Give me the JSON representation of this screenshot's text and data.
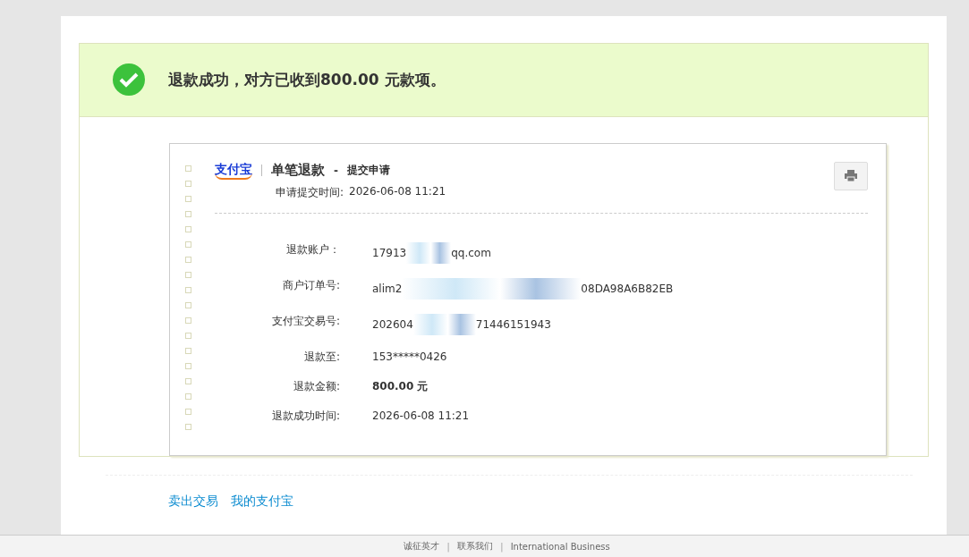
{
  "banner": {
    "message": "退款成功，对方已收到**800.00** 元款项。"
  },
  "receipt": {
    "brand": "支付宝",
    "title": "单笔退款",
    "separator": "-",
    "step": "提交申请",
    "submitted_label": "申请提交时间:",
    "submitted_time": "2026-06-08 11:21",
    "rows": [
      {
        "label": "退款账户：",
        "parts": [
          {
            "kind": "text",
            "text": "17913"
          },
          {
            "kind": "redaction"
          },
          {
            "kind": "text",
            "text": "qq.com"
          }
        ],
        "emphasis": false
      },
      {
        "label": "商户订单号:",
        "parts": [
          {
            "kind": "text",
            "text": "alim2"
          },
          {
            "kind": "redaction"
          },
          {
            "kind": "text",
            "text": "08DA98A6B82EB"
          }
        ],
        "emphasis": false
      },
      {
        "label": "支付宝交易号:",
        "parts": [
          {
            "kind": "text",
            "text": "202604"
          },
          {
            "kind": "redaction"
          },
          {
            "kind": "text",
            "text": "71446151943"
          }
        ],
        "emphasis": false
      },
      {
        "label": "退款至:",
        "parts": [
          {
            "kind": "text",
            "text": "153*****0426"
          }
        ],
        "emphasis": false
      },
      {
        "label": "退款金额:",
        "parts": [
          {
            "kind": "text",
            "text": "800.00 元"
          }
        ],
        "emphasis": true
      },
      {
        "label": "退款成功时间:",
        "parts": [
          {
            "kind": "text",
            "text": "2026-06-08 11:21"
          }
        ],
        "emphasis": false
      }
    ]
  },
  "links": [
    "卖出交易",
    "我的支付宝"
  ],
  "footer": [
    {
      "kind": "link",
      "text": "诚征英才"
    },
    {
      "kind": "separator",
      "text": "|"
    },
    {
      "kind": "link",
      "text": "联系我们"
    },
    {
      "kind": "separator",
      "text": "|"
    },
    {
      "kind": "link",
      "text": "International Business"
    }
  ]
}
